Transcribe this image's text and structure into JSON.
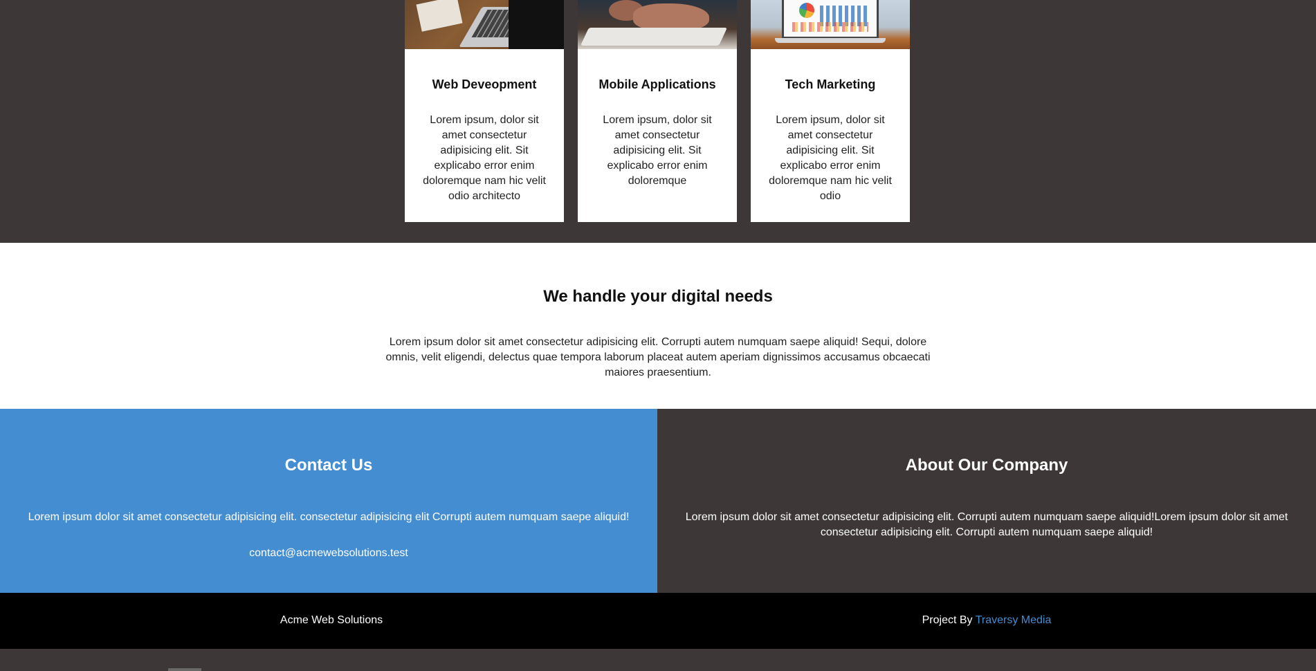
{
  "services": {
    "cards": [
      {
        "title": "Web Deveopment",
        "text": "Lorem ipsum, dolor sit amet consectetur adipisicing elit. Sit explicabo error enim doloremque nam hic velit odio architecto"
      },
      {
        "title": "Mobile Applications",
        "text": "Lorem ipsum, dolor sit amet consectetur adipisicing elit. Sit explicabo error enim doloremque"
      },
      {
        "title": "Tech Marketing",
        "text": "Lorem ipsum, dolor sit amet consectetur adipisicing elit. Sit explicabo error enim doloremque nam hic velit odio"
      }
    ]
  },
  "digital": {
    "heading": "We handle your digital needs",
    "text": "Lorem ipsum dolor sit amet consectetur adipisicing elit. Corrupti autem numquam saepe aliquid! Sequi, dolore omnis, velit eligendi, delectus quae tempora laborum placeat autem aperiam dignissimos accusamus obcaecati maiores praesentium."
  },
  "contact": {
    "heading": "Contact Us",
    "text": "Lorem ipsum dolor sit amet consectetur adipisicing elit. consectetur adipisicing elit Corrupti autem numquam saepe aliquid!",
    "email": "contact@acmewebsolutions.test"
  },
  "about": {
    "heading": "About Our Company",
    "text": "Lorem ipsum dolor sit amet consectetur adipisicing elit. Corrupti autem numquam saepe aliquid!Lorem ipsum dolor sit amet consectetur adipisicing elit. Corrupti autem numquam saepe aliquid!"
  },
  "footer": {
    "brand": "Acme Web Solutions",
    "credit_prefix": "Project By ",
    "credit_link": "Traversy Media"
  },
  "colors": {
    "dark_bg": "#3d3737",
    "accent_blue": "#448dd1",
    "footer_bg": "#000000"
  }
}
